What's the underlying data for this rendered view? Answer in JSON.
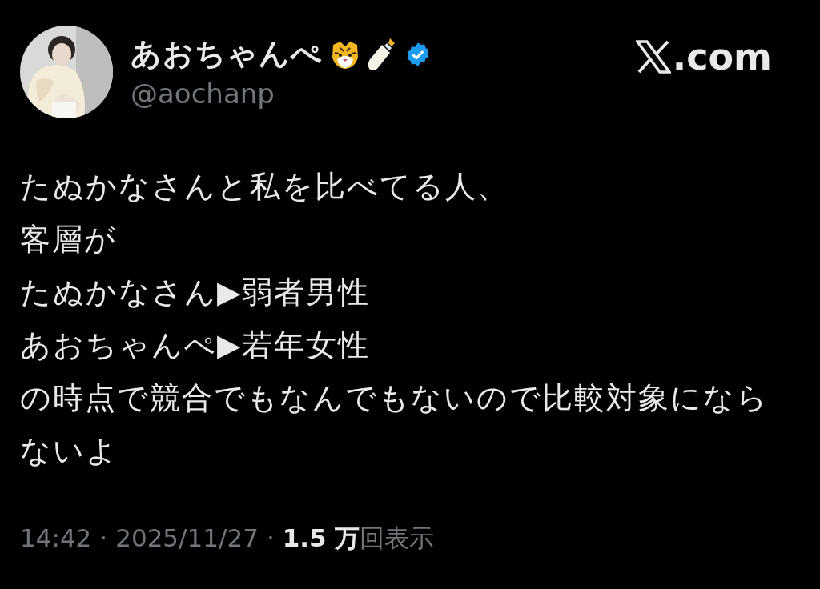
{
  "author": {
    "name": "あおちゃんぺ",
    "handle": "@aochanp",
    "verified": true
  },
  "brand": {
    "suffix": ".com"
  },
  "text": [
    "たぬかなさんと私を比べてる人、",
    "客層が",
    "たぬかなさん▶弱者男性",
    "あおちゃんぺ▶若年女性",
    "の時点で競合でもなんでもないので比較対象にならないよ"
  ],
  "footer": {
    "time": "14:42",
    "separator_1": "·",
    "date": "2025/11/27",
    "separator_2": "·",
    "views_count": "1.5 万",
    "views_label": "回表示"
  }
}
